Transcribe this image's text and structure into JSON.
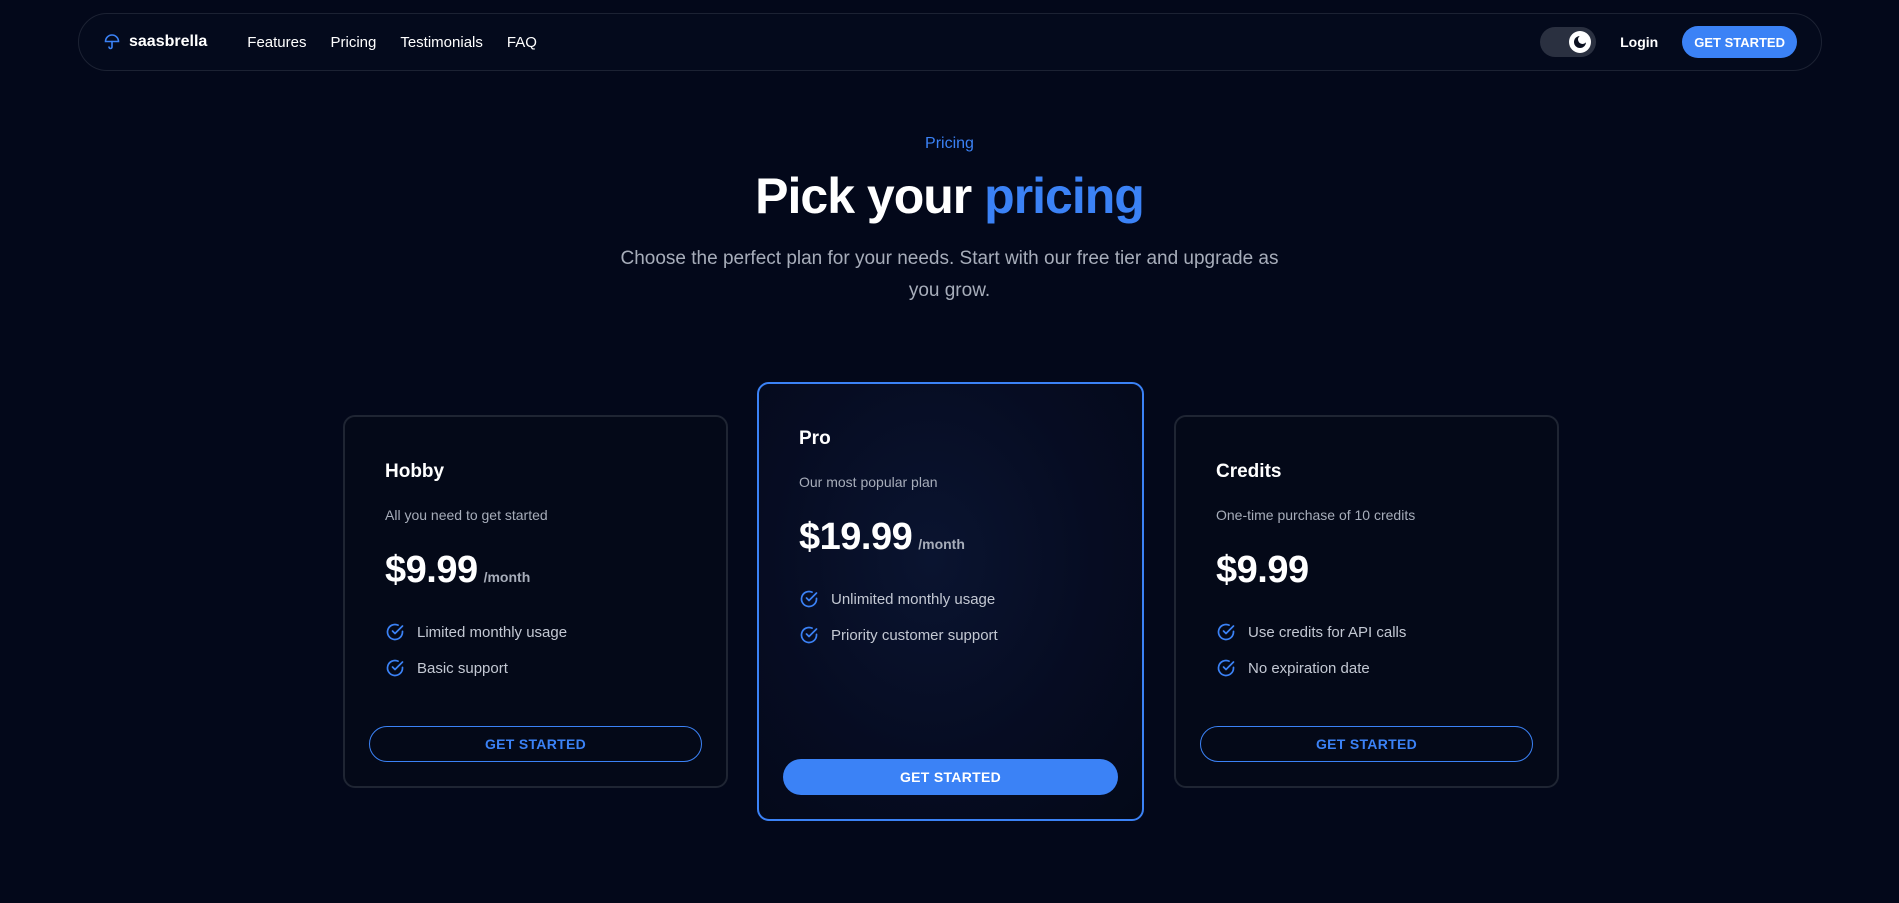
{
  "nav": {
    "brand": "saasbrella",
    "brand_icon": "umbrella-icon",
    "links": [
      "Features",
      "Pricing",
      "Testimonials",
      "FAQ"
    ],
    "login": "Login",
    "cta": "GET STARTED",
    "theme_toggle_icon": "moon-icon"
  },
  "hero": {
    "eyebrow": "Pricing",
    "headline_plain": "Pick your ",
    "headline_accent": "pricing",
    "subtitle": "Choose the perfect plan for your needs. Start with our free tier and upgrade as you grow."
  },
  "plans": [
    {
      "name": "Hobby",
      "description": "All you need to get started",
      "price": "$9.99",
      "period": "/month",
      "features": [
        "Limited monthly usage",
        "Basic support"
      ],
      "button": "GET STARTED"
    },
    {
      "name": "Pro",
      "description": "Our most popular plan",
      "price": "$19.99",
      "period": "/month",
      "features": [
        "Unlimited monthly usage",
        "Priority customer support"
      ],
      "button": "GET STARTED"
    },
    {
      "name": "Credits",
      "description": "One-time purchase of 10 credits",
      "price": "$9.99",
      "features": [
        "Use credits for API calls",
        "No expiration date"
      ],
      "button": "GET STARTED"
    }
  ],
  "colors": {
    "background": "#03081a",
    "accent": "#3b82f6",
    "muted_text": "#a7adba",
    "card_border": "#1f2533"
  }
}
